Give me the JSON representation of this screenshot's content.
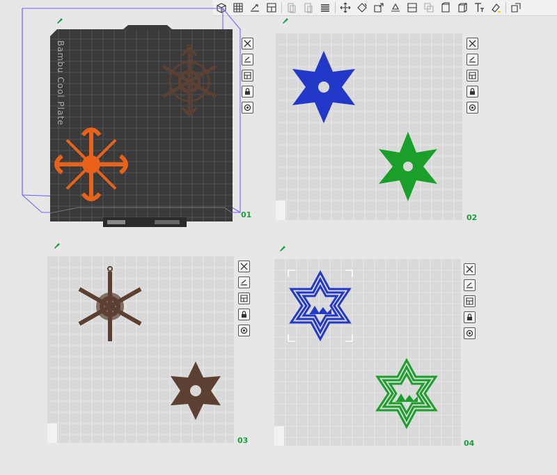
{
  "toolbar": {
    "items": [
      {
        "icon": "add-object-icon"
      },
      {
        "icon": "arrange-grid-icon"
      },
      {
        "icon": "orient-icon"
      },
      {
        "icon": "add-plate-icon"
      },
      {
        "icon": "split-objects-icon"
      },
      {
        "icon": "split-parts-icon"
      },
      {
        "icon": "layers-icon"
      },
      {
        "icon": "move-icon"
      },
      {
        "icon": "rotate-icon"
      },
      {
        "icon": "scale-icon"
      },
      {
        "icon": "lay-on-face-icon"
      },
      {
        "icon": "cut-icon"
      },
      {
        "icon": "mesh-boolean-icon"
      },
      {
        "icon": "support-paint-icon"
      },
      {
        "icon": "seam-paint-icon"
      },
      {
        "icon": "text-icon"
      },
      {
        "icon": "color-paint-icon"
      },
      {
        "icon": "assembly-view-icon"
      }
    ]
  },
  "plates": [
    {
      "number": "01",
      "label": "Bambu Cool Plate",
      "selected": true
    },
    {
      "number": "02",
      "selected": false
    },
    {
      "number": "03",
      "selected": false
    },
    {
      "number": "04",
      "selected": false
    }
  ],
  "plate_actions": [
    "close-icon",
    "auto-orient-icon",
    "arrange-icon",
    "lock-icon",
    "settings-icon"
  ],
  "colors": {
    "orange": "#e8621a",
    "brown": "#5c4032",
    "blue": "#2238c8",
    "green": "#1aa02a",
    "plate_number": "#1aa03a",
    "selection": "#6d62ff",
    "dark_plate": "#3a3a3a",
    "light_plate": "#d9d9d9"
  }
}
